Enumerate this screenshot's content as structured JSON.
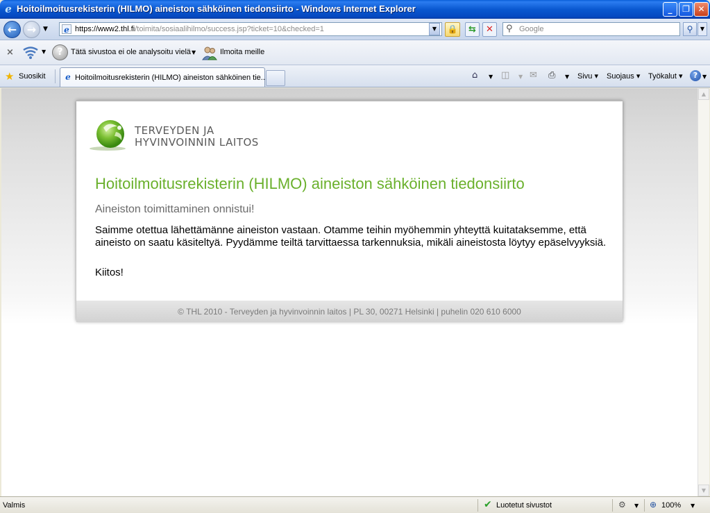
{
  "window": {
    "title": "Hoitoilmoitusrekisterin (HILMO) aineiston sähköinen tiedonsiirto - Windows Internet Explorer",
    "minimize_glyph": "_",
    "maximize_glyph": "❐",
    "close_glyph": "✕"
  },
  "address": {
    "url_host": "https://www2.thl.fi",
    "url_path": "/toimita/sosiaalihilmo/success.jsp?ticket=10&checked=1",
    "search_placeholder": "Google"
  },
  "analysis_toolbar": {
    "status_text": "Tätä sivustoa ei ole analysoitu vielä",
    "report_label": "Ilmoita meille"
  },
  "tabs": {
    "favorites_label": "Suosikit",
    "active_tab_label": "Hoitoilmoitusrekisterin (HILMO) aineiston sähköinen tie...",
    "commands": {
      "page": "Sivu",
      "safety": "Suojaus",
      "tools": "Työkalut"
    }
  },
  "page": {
    "logo_line1": "TERVEYDEN JA",
    "logo_line2": "HYVINVOINNIN LAITOS",
    "title": "Hoitoilmoitusrekisterin (HILMO) aineiston sähköinen tiedonsiirto",
    "subtitle": "Aineiston toimittaminen onnistui!",
    "message": "Saimme otettua lähettämänne aineiston vastaan. Otamme teihin myöhemmin yhteyttä kuitataksemme, että aineisto on saatu käsiteltyä. Pyydämme teiltä tarvittaessa tarkennuksia, mikäli aineistosta löytyy epäselvyyksiä.",
    "thanks": "Kiitos!",
    "footer": "© THL 2010 - Terveyden ja hyvinvoinnin laitos | PL 30, 00271 Helsinki | puhelin 020 610 6000"
  },
  "status": {
    "text": "Valmis",
    "zone": "Luotetut sivustot",
    "zoom": "100%"
  },
  "colors": {
    "title_green": "#6ab02c",
    "titlebar_blue": "#0a58d0"
  }
}
